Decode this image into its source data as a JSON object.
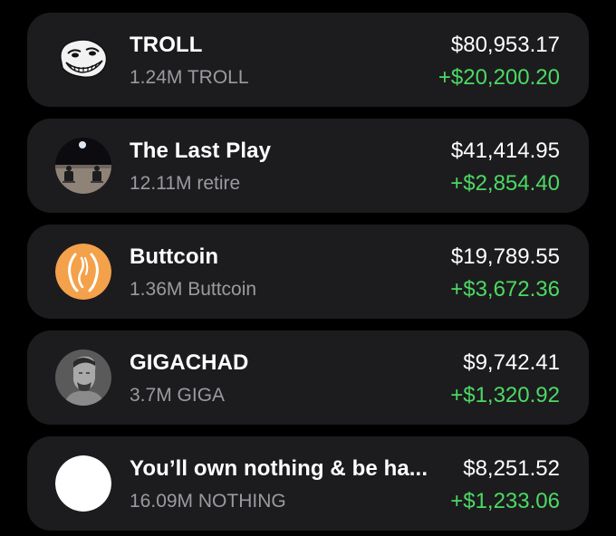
{
  "colors": {
    "background": "#000000",
    "card": "#1c1c1e",
    "primary_text": "#ffffff",
    "secondary_text": "#9a9aa0",
    "gain": "#4cd964"
  },
  "holdings": [
    {
      "name": "TROLL",
      "amount": "1.24M TROLL",
      "value": "$80,953.17",
      "change": "+$20,200.20",
      "icon": "trollface-icon"
    },
    {
      "name": "The Last Play",
      "amount": "12.11M retire",
      "value": "$41,414.95",
      "change": "+$2,854.40",
      "icon": "moon-astronauts-icon"
    },
    {
      "name": "Buttcoin",
      "amount": "1.36M Buttcoin",
      "value": "$19,789.55",
      "change": "+$3,672.36",
      "icon": "buttcoin-icon"
    },
    {
      "name": "GIGACHAD",
      "amount": "3.7M GIGA",
      "value": "$9,742.41",
      "change": "+$1,320.92",
      "icon": "gigachad-portrait-icon"
    },
    {
      "name": "You’ll own nothing & be ha...",
      "amount": "16.09M NOTHING",
      "value": "$8,251.52",
      "change": "+$1,233.06",
      "icon": "white-circle-icon"
    }
  ]
}
